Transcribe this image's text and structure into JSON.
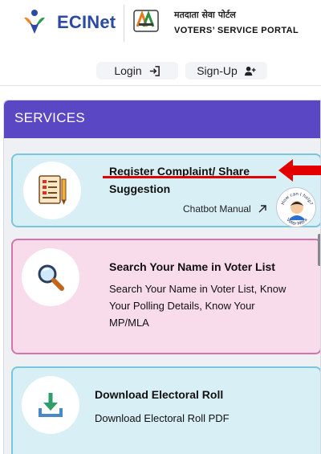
{
  "header": {
    "brand": "ECINet",
    "portal_hindi": "मतदाता सेवा पोर्टल",
    "portal_english": "VOTERS’ SERVICE PORTAL"
  },
  "auth": {
    "login_label": "Login",
    "signup_label": "Sign-Up"
  },
  "services": {
    "title": "SERVICES",
    "cards": [
      {
        "title": "Register Complaint/ Share Suggestion",
        "link": "Chatbot Manual",
        "icon": "complaint-form-icon"
      },
      {
        "title": "Search Your Name in Voter List",
        "description": "Search Your Name in Voter List, Know Your Polling Details, Know Your MP/MLA",
        "icon": "magnifier-icon"
      },
      {
        "title": "Download Electoral Roll",
        "description": "Download Electoral Roll PDF",
        "icon": "download-tray-icon"
      }
    ]
  },
  "chatbot": {
    "tagline": "How can I help?",
    "name": "Voter Mitra"
  },
  "colors": {
    "brand_blue": "#2a4aa3",
    "services_bar": "#5a47c4",
    "card_blue_bg": "#d9eff6",
    "card_pink_bg": "#f9dcec",
    "annotation_red": "#e30000"
  }
}
